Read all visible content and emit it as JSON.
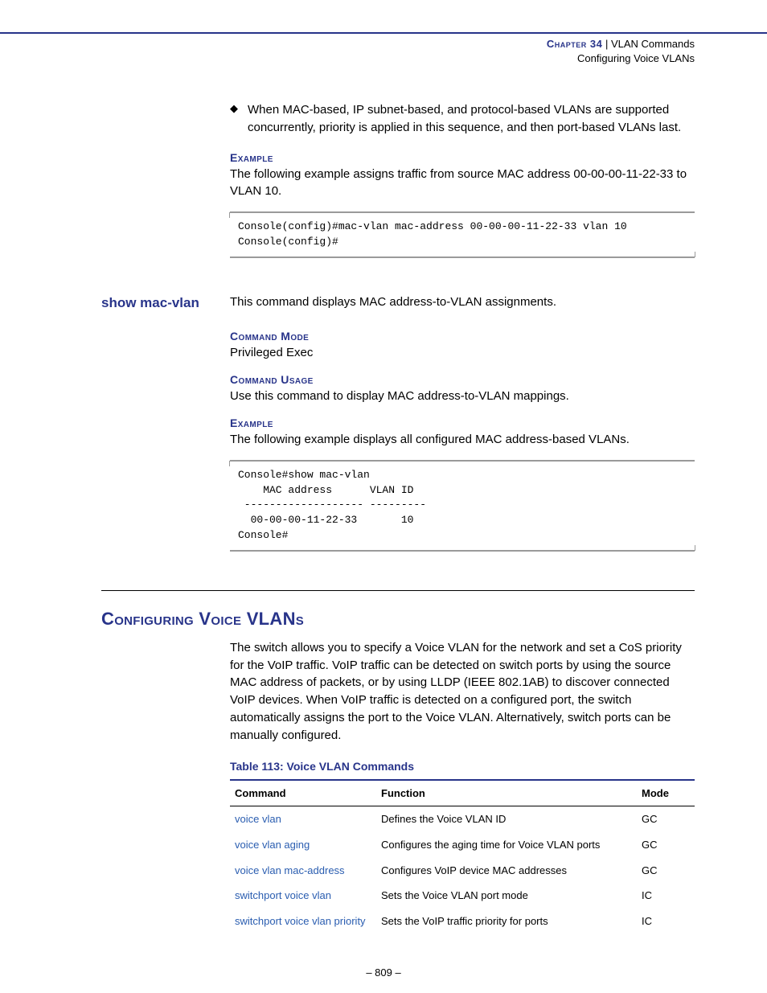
{
  "header": {
    "chapter_label": "Chapter 34",
    "separator": "  |  ",
    "title": "VLAN Commands",
    "subtitle": "Configuring Voice VLANs"
  },
  "intro": {
    "bullet": "When MAC-based, IP subnet-based, and protocol-based VLANs are supported concurrently, priority is applied in this sequence, and then port-based VLANs last."
  },
  "example1": {
    "label": "Example",
    "text": "The following example assigns traffic from source MAC address 00-00-00-11-22-33 to VLAN 10.",
    "code": "Console(config)#mac-vlan mac-address 00-00-00-11-22-33 vlan 10\nConsole(config)#"
  },
  "cmd": {
    "name": "show mac-vlan",
    "desc": "This command displays MAC address-to-VLAN assignments.",
    "mode_label": "Command Mode",
    "mode_text": "Privileged Exec",
    "usage_label": "Command Usage",
    "usage_text": "Use this command to display MAC address-to-VLAN mappings.",
    "example_label": "Example",
    "example_text": "The following example displays all configured MAC address-based VLANs.",
    "example_code": "Console#show mac-vlan\n    MAC address      VLAN ID\n ------------------- ---------\n  00-00-00-11-22-33       10\nConsole#"
  },
  "section": {
    "heading": "Configuring Voice VLANs",
    "body": "The switch allows you to specify a Voice VLAN for the network and set a CoS priority for the VoIP traffic. VoIP traffic can be detected on switch ports by using the source MAC address of packets, or by using LLDP (IEEE 802.1AB) to discover connected VoIP devices. When VoIP traffic is detected on a configured port, the switch automatically assigns the port to the Voice VLAN. Alternatively, switch ports can be manually configured."
  },
  "table": {
    "caption": "Table 113: Voice VLAN Commands",
    "headers": {
      "command": "Command",
      "function": "Function",
      "mode": "Mode"
    },
    "rows": [
      {
        "command": "voice vlan",
        "function": "Defines the Voice VLAN ID",
        "mode": "GC"
      },
      {
        "command": "voice vlan aging",
        "function": "Configures the aging time for Voice VLAN ports",
        "mode": "GC"
      },
      {
        "command": "voice vlan mac-address",
        "function": "Configures VoIP device MAC addresses",
        "mode": "GC"
      },
      {
        "command": "switchport voice vlan",
        "function": "Sets the Voice VLAN port mode",
        "mode": "IC"
      },
      {
        "command": "switchport voice vlan priority",
        "function": "Sets the VoIP traffic priority for ports",
        "mode": "IC"
      }
    ]
  },
  "footer": {
    "page": "–  809  –"
  }
}
